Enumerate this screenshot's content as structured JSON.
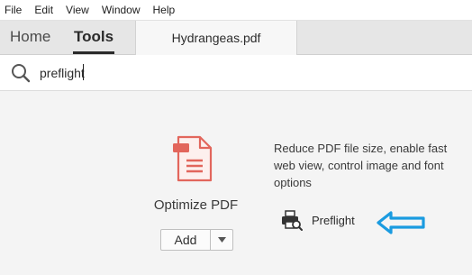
{
  "menu": {
    "items": [
      "File",
      "Edit",
      "View",
      "Window",
      "Help"
    ]
  },
  "tabs": {
    "home": "Home",
    "tools": "Tools",
    "document": "Hydrangeas.pdf"
  },
  "search": {
    "value": "preflight",
    "icon": "search-icon"
  },
  "tool": {
    "name": "Optimize PDF",
    "icon": "optimize-pdf-icon",
    "icon_color": "#e2665c",
    "add_label": "Add",
    "description": "Reduce PDF file size, enable fast web view, control image and font options"
  },
  "preflight": {
    "label": "Preflight",
    "icon": "preflight-printer-icon"
  },
  "annotation": {
    "arrow_color": "#1a9be0"
  }
}
